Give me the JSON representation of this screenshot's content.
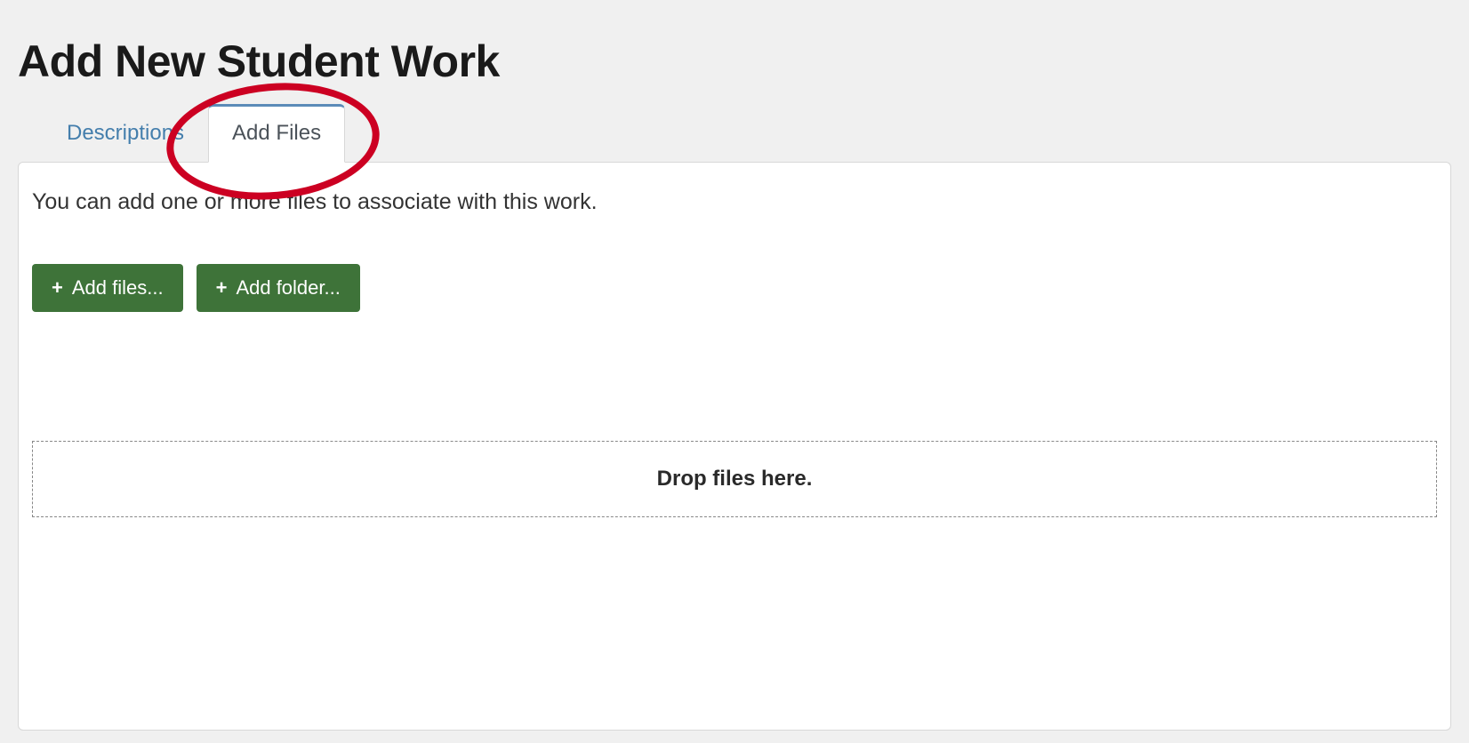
{
  "page": {
    "title": "Add New Student Work"
  },
  "tabs": [
    {
      "label": "Descriptions"
    },
    {
      "label": "Add Files"
    }
  ],
  "panel": {
    "intro": "You can add one or more files to associate with this work.",
    "buttons": {
      "add_files": "Add files...",
      "add_folder": "Add folder..."
    },
    "dropzone": "Drop files here."
  }
}
